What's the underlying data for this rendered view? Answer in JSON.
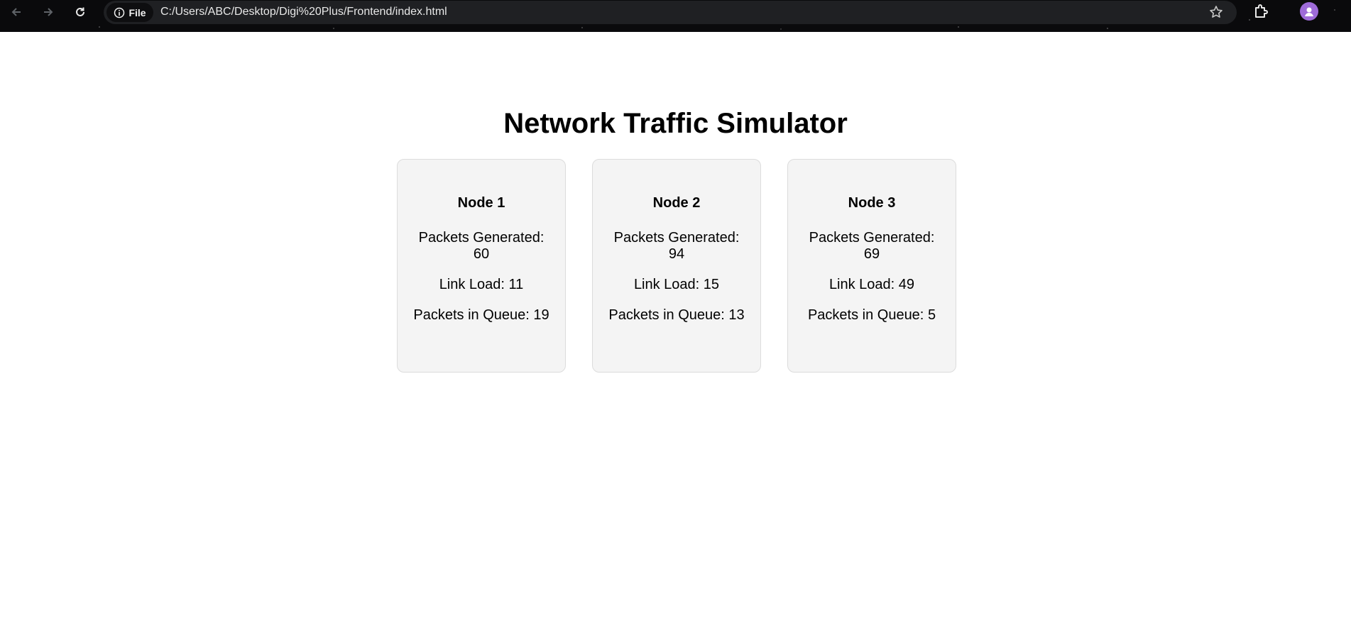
{
  "browser": {
    "site_info_label": "File",
    "url": "C:/Users/ABC/Desktop/Digi%20Plus/Frontend/index.html",
    "icons": [
      "back-arrow-icon",
      "forward-arrow-icon",
      "reload-icon",
      "info-icon",
      "star-icon",
      "extensions-icon",
      "profile-avatar-icon"
    ]
  },
  "page": {
    "title": "Network Traffic Simulator"
  },
  "labels": {
    "packets_generated": "Packets Generated:",
    "link_load": "Link Load:",
    "packets_in_queue": "Packets in Queue:"
  },
  "nodes": [
    {
      "name": "Node 1",
      "packets_generated": "60",
      "link_load": "11",
      "packets_in_queue": "19"
    },
    {
      "name": "Node 2",
      "packets_generated": "94",
      "link_load": "15",
      "packets_in_queue": "13"
    },
    {
      "name": "Node 3",
      "packets_generated": "69",
      "link_load": "49",
      "packets_in_queue": "5"
    }
  ],
  "colors": {
    "card_background": "#f4f4f4",
    "card_border": "#dcdcdc",
    "browser_bar": "#0a0a0c",
    "omnibox": "#1f2023",
    "avatar": "#9e6bd9"
  }
}
